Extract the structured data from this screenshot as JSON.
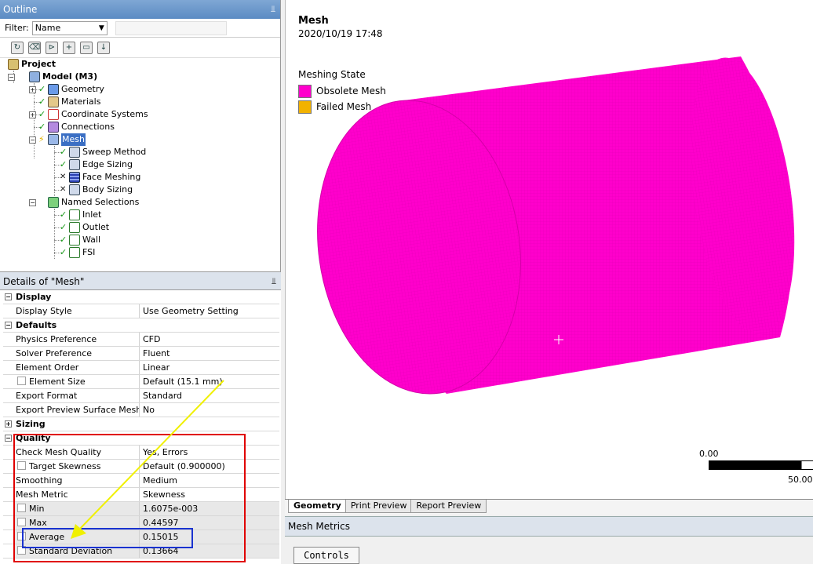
{
  "outline": {
    "title": "Outline",
    "pin_glyph": "⫫",
    "filter_label": "Filter:",
    "filter_value": "Name",
    "filter_text": "",
    "toolbar_icons": [
      "refresh-icon",
      "clear-icon",
      "tree-expand-icon",
      "plus-icon",
      "folder-icon",
      "sort-icon"
    ],
    "tree": {
      "project": "Project",
      "model": "Model (M3)",
      "geometry": "Geometry",
      "materials": "Materials",
      "coordinate_systems": "Coordinate Systems",
      "connections": "Connections",
      "mesh": "Mesh",
      "sweep_method": "Sweep Method",
      "edge_sizing": "Edge Sizing",
      "face_meshing": "Face Meshing",
      "body_sizing": "Body Sizing",
      "named_selections": "Named Selections",
      "inlet": "Inlet",
      "outlet": "Outlet",
      "wall": "Wall",
      "fsi": "FSI"
    }
  },
  "details": {
    "title": "Details of \"Mesh\"",
    "groups": {
      "display": "Display",
      "defaults": "Defaults",
      "sizing": "Sizing",
      "quality": "Quality"
    },
    "rows": {
      "display_style": {
        "k": "Display Style",
        "v": "Use Geometry Setting"
      },
      "physics_preference": {
        "k": "Physics Preference",
        "v": "CFD"
      },
      "solver_preference": {
        "k": "Solver Preference",
        "v": "Fluent"
      },
      "element_order": {
        "k": "Element Order",
        "v": "Linear"
      },
      "element_size": {
        "k": "Element Size",
        "v": "Default (15.1 mm)"
      },
      "export_format": {
        "k": "Export Format",
        "v": "Standard"
      },
      "export_preview": {
        "k": "Export Preview Surface Mesh",
        "v": "No"
      },
      "check_mesh_quality": {
        "k": "Check Mesh Quality",
        "v": "Yes, Errors"
      },
      "target_skewness": {
        "k": "Target Skewness",
        "v": "Default (0.900000)"
      },
      "smoothing": {
        "k": "Smoothing",
        "v": "Medium"
      },
      "mesh_metric": {
        "k": "Mesh Metric",
        "v": "Skewness"
      },
      "min": {
        "k": "Min",
        "v": "1.6075e-003"
      },
      "max": {
        "k": "Max",
        "v": "0.44597"
      },
      "average": {
        "k": "Average",
        "v": "0.15015"
      },
      "std_dev": {
        "k": "Standard Deviation",
        "v": "0.13664"
      }
    }
  },
  "viewport": {
    "title": "Mesh",
    "date": "2020/10/19 17:48",
    "legend_title": "Meshing State",
    "legend": [
      {
        "label": "Obsolete Mesh",
        "color": "#ff00cc"
      },
      {
        "label": "Failed Mesh",
        "color": "#f2b200"
      }
    ],
    "scale_min": "0.00",
    "scale_max": "50.00",
    "mesh_color": "#ff00cc"
  },
  "tabs": [
    "Geometry",
    "Print Preview",
    "Report Preview"
  ],
  "metrics_title": "Mesh Metrics",
  "controls_button": "Controls",
  "annotation_colors": {
    "red_box": "#e00000",
    "blue_box": "#1a33d0",
    "arrow": "#f0f000"
  }
}
